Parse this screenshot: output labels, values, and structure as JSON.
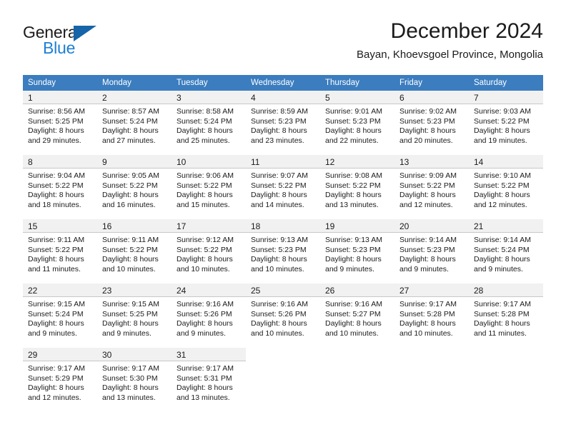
{
  "brand": {
    "name_top": "General",
    "name_bottom": "Blue",
    "triangle_color": "#1565a8",
    "blue_color": "#1d7fd4"
  },
  "header": {
    "title": "December 2024",
    "subtitle": "Bayan, Khoevsgoel Province, Mongolia"
  },
  "theme": {
    "header_bg": "#3b7dbf",
    "header_text": "#ffffff",
    "daynum_bg": "#f1f1f1",
    "cell_bg": "#ffffff",
    "grid_line": "#c8c8c8",
    "text": "#1b1b1b"
  },
  "weekdays": [
    "Sunday",
    "Monday",
    "Tuesday",
    "Wednesday",
    "Thursday",
    "Friday",
    "Saturday"
  ],
  "weeks": [
    [
      {
        "day": "1",
        "lines": [
          "Sunrise: 8:56 AM",
          "Sunset: 5:25 PM",
          "Daylight: 8 hours",
          "and 29 minutes."
        ]
      },
      {
        "day": "2",
        "lines": [
          "Sunrise: 8:57 AM",
          "Sunset: 5:24 PM",
          "Daylight: 8 hours",
          "and 27 minutes."
        ]
      },
      {
        "day": "3",
        "lines": [
          "Sunrise: 8:58 AM",
          "Sunset: 5:24 PM",
          "Daylight: 8 hours",
          "and 25 minutes."
        ]
      },
      {
        "day": "4",
        "lines": [
          "Sunrise: 8:59 AM",
          "Sunset: 5:23 PM",
          "Daylight: 8 hours",
          "and 23 minutes."
        ]
      },
      {
        "day": "5",
        "lines": [
          "Sunrise: 9:01 AM",
          "Sunset: 5:23 PM",
          "Daylight: 8 hours",
          "and 22 minutes."
        ]
      },
      {
        "day": "6",
        "lines": [
          "Sunrise: 9:02 AM",
          "Sunset: 5:23 PM",
          "Daylight: 8 hours",
          "and 20 minutes."
        ]
      },
      {
        "day": "7",
        "lines": [
          "Sunrise: 9:03 AM",
          "Sunset: 5:22 PM",
          "Daylight: 8 hours",
          "and 19 minutes."
        ]
      }
    ],
    [
      {
        "day": "8",
        "lines": [
          "Sunrise: 9:04 AM",
          "Sunset: 5:22 PM",
          "Daylight: 8 hours",
          "and 18 minutes."
        ]
      },
      {
        "day": "9",
        "lines": [
          "Sunrise: 9:05 AM",
          "Sunset: 5:22 PM",
          "Daylight: 8 hours",
          "and 16 minutes."
        ]
      },
      {
        "day": "10",
        "lines": [
          "Sunrise: 9:06 AM",
          "Sunset: 5:22 PM",
          "Daylight: 8 hours",
          "and 15 minutes."
        ]
      },
      {
        "day": "11",
        "lines": [
          "Sunrise: 9:07 AM",
          "Sunset: 5:22 PM",
          "Daylight: 8 hours",
          "and 14 minutes."
        ]
      },
      {
        "day": "12",
        "lines": [
          "Sunrise: 9:08 AM",
          "Sunset: 5:22 PM",
          "Daylight: 8 hours",
          "and 13 minutes."
        ]
      },
      {
        "day": "13",
        "lines": [
          "Sunrise: 9:09 AM",
          "Sunset: 5:22 PM",
          "Daylight: 8 hours",
          "and 12 minutes."
        ]
      },
      {
        "day": "14",
        "lines": [
          "Sunrise: 9:10 AM",
          "Sunset: 5:22 PM",
          "Daylight: 8 hours",
          "and 12 minutes."
        ]
      }
    ],
    [
      {
        "day": "15",
        "lines": [
          "Sunrise: 9:11 AM",
          "Sunset: 5:22 PM",
          "Daylight: 8 hours",
          "and 11 minutes."
        ]
      },
      {
        "day": "16",
        "lines": [
          "Sunrise: 9:11 AM",
          "Sunset: 5:22 PM",
          "Daylight: 8 hours",
          "and 10 minutes."
        ]
      },
      {
        "day": "17",
        "lines": [
          "Sunrise: 9:12 AM",
          "Sunset: 5:22 PM",
          "Daylight: 8 hours",
          "and 10 minutes."
        ]
      },
      {
        "day": "18",
        "lines": [
          "Sunrise: 9:13 AM",
          "Sunset: 5:23 PM",
          "Daylight: 8 hours",
          "and 10 minutes."
        ]
      },
      {
        "day": "19",
        "lines": [
          "Sunrise: 9:13 AM",
          "Sunset: 5:23 PM",
          "Daylight: 8 hours",
          "and 9 minutes."
        ]
      },
      {
        "day": "20",
        "lines": [
          "Sunrise: 9:14 AM",
          "Sunset: 5:23 PM",
          "Daylight: 8 hours",
          "and 9 minutes."
        ]
      },
      {
        "day": "21",
        "lines": [
          "Sunrise: 9:14 AM",
          "Sunset: 5:24 PM",
          "Daylight: 8 hours",
          "and 9 minutes."
        ]
      }
    ],
    [
      {
        "day": "22",
        "lines": [
          "Sunrise: 9:15 AM",
          "Sunset: 5:24 PM",
          "Daylight: 8 hours",
          "and 9 minutes."
        ]
      },
      {
        "day": "23",
        "lines": [
          "Sunrise: 9:15 AM",
          "Sunset: 5:25 PM",
          "Daylight: 8 hours",
          "and 9 minutes."
        ]
      },
      {
        "day": "24",
        "lines": [
          "Sunrise: 9:16 AM",
          "Sunset: 5:26 PM",
          "Daylight: 8 hours",
          "and 9 minutes."
        ]
      },
      {
        "day": "25",
        "lines": [
          "Sunrise: 9:16 AM",
          "Sunset: 5:26 PM",
          "Daylight: 8 hours",
          "and 10 minutes."
        ]
      },
      {
        "day": "26",
        "lines": [
          "Sunrise: 9:16 AM",
          "Sunset: 5:27 PM",
          "Daylight: 8 hours",
          "and 10 minutes."
        ]
      },
      {
        "day": "27",
        "lines": [
          "Sunrise: 9:17 AM",
          "Sunset: 5:28 PM",
          "Daylight: 8 hours",
          "and 10 minutes."
        ]
      },
      {
        "day": "28",
        "lines": [
          "Sunrise: 9:17 AM",
          "Sunset: 5:28 PM",
          "Daylight: 8 hours",
          "and 11 minutes."
        ]
      }
    ],
    [
      {
        "day": "29",
        "lines": [
          "Sunrise: 9:17 AM",
          "Sunset: 5:29 PM",
          "Daylight: 8 hours",
          "and 12 minutes."
        ]
      },
      {
        "day": "30",
        "lines": [
          "Sunrise: 9:17 AM",
          "Sunset: 5:30 PM",
          "Daylight: 8 hours",
          "and 13 minutes."
        ]
      },
      {
        "day": "31",
        "lines": [
          "Sunrise: 9:17 AM",
          "Sunset: 5:31 PM",
          "Daylight: 8 hours",
          "and 13 minutes."
        ]
      },
      {
        "day": "",
        "lines": []
      },
      {
        "day": "",
        "lines": []
      },
      {
        "day": "",
        "lines": []
      },
      {
        "day": "",
        "lines": []
      }
    ]
  ]
}
